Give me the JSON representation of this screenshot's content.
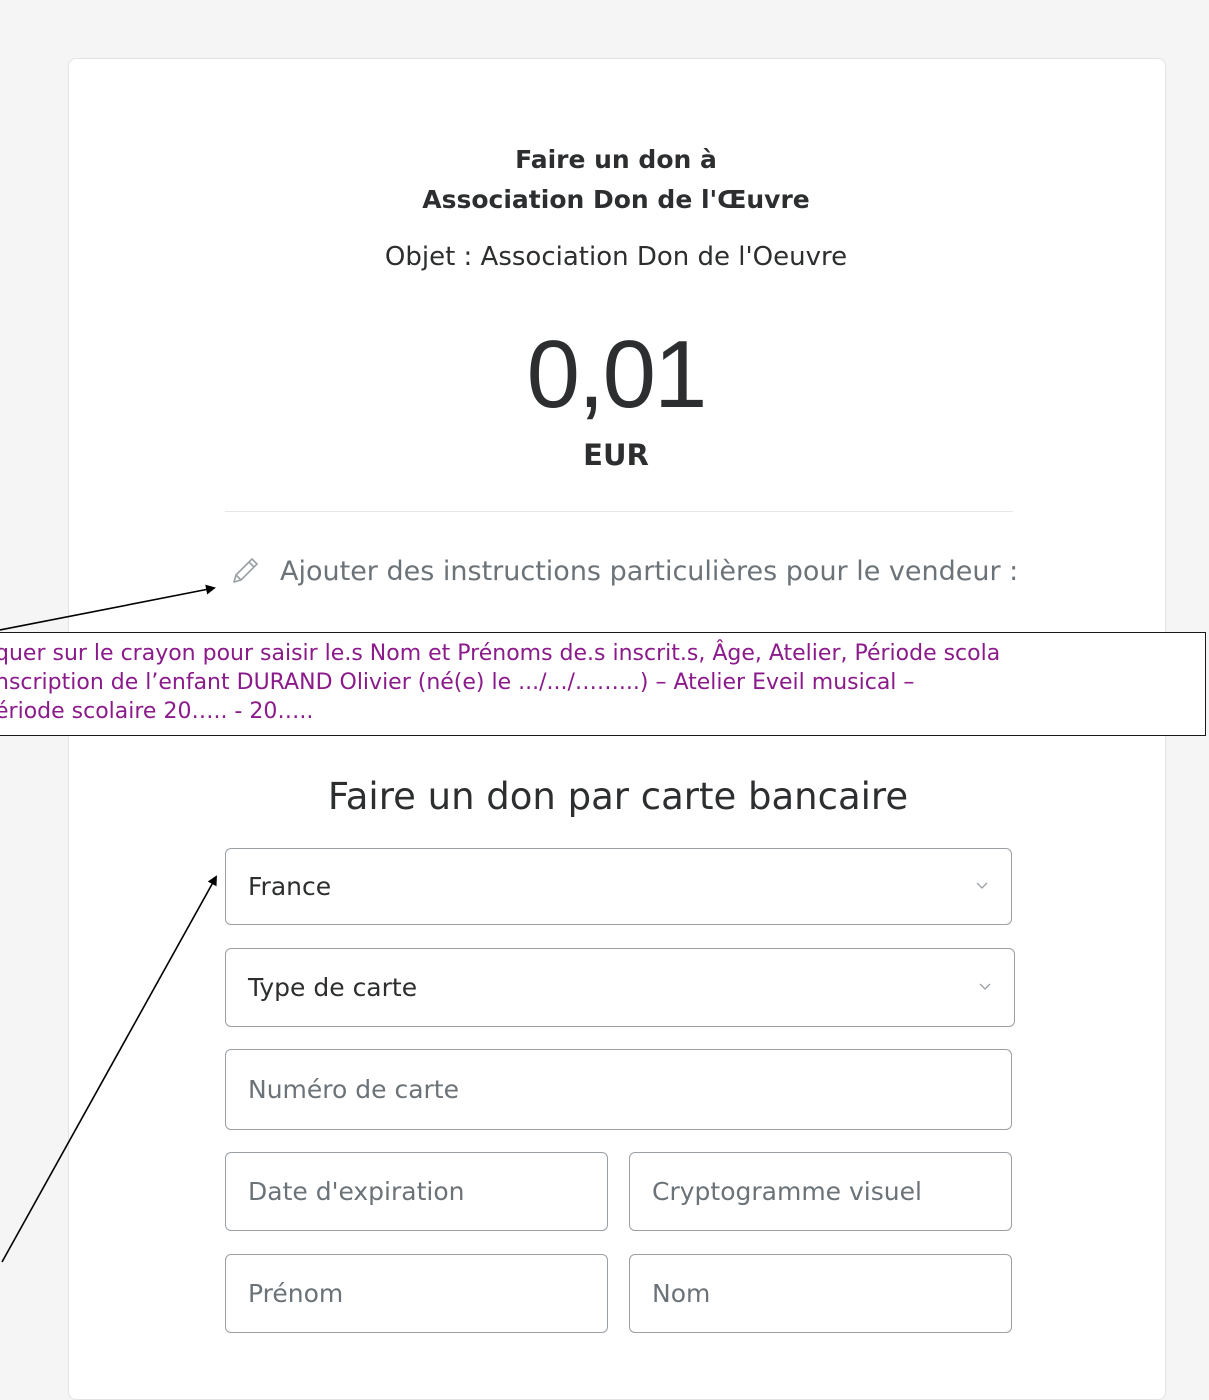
{
  "header": {
    "title_line1": "Faire un don à",
    "title_line2": "Association Don de l'Œuvre",
    "subject": "Objet : Association Don de l'Oeuvre"
  },
  "amount": {
    "value": "0,01",
    "currency": "EUR"
  },
  "instructions": {
    "link_label": "Ajouter des instructions particulières pour le vendeur :",
    "icon": "pencil-icon"
  },
  "annotation": {
    "line1": "quer sur le crayon pour saisir le.s Nom et Prénoms de.s inscrit.s, Âge, Atelier, Période scola",
    "line2": "nscription de l’enfant DURAND Olivier (né(e) le .../.../……...) – Atelier Eveil musical –",
    "line3": "ériode scolaire 20….. - 20…..",
    "text_color": "#8b1a8b"
  },
  "form": {
    "title": "Faire un don par carte bancaire",
    "country_value": "France",
    "card_type_placeholder": "Type de carte",
    "card_number_placeholder": "Numéro de carte",
    "expiration_placeholder": "Date d'expiration",
    "cvv_placeholder": "Cryptogramme visuel",
    "first_name_placeholder": "Prénom",
    "last_name_placeholder": "Nom"
  }
}
